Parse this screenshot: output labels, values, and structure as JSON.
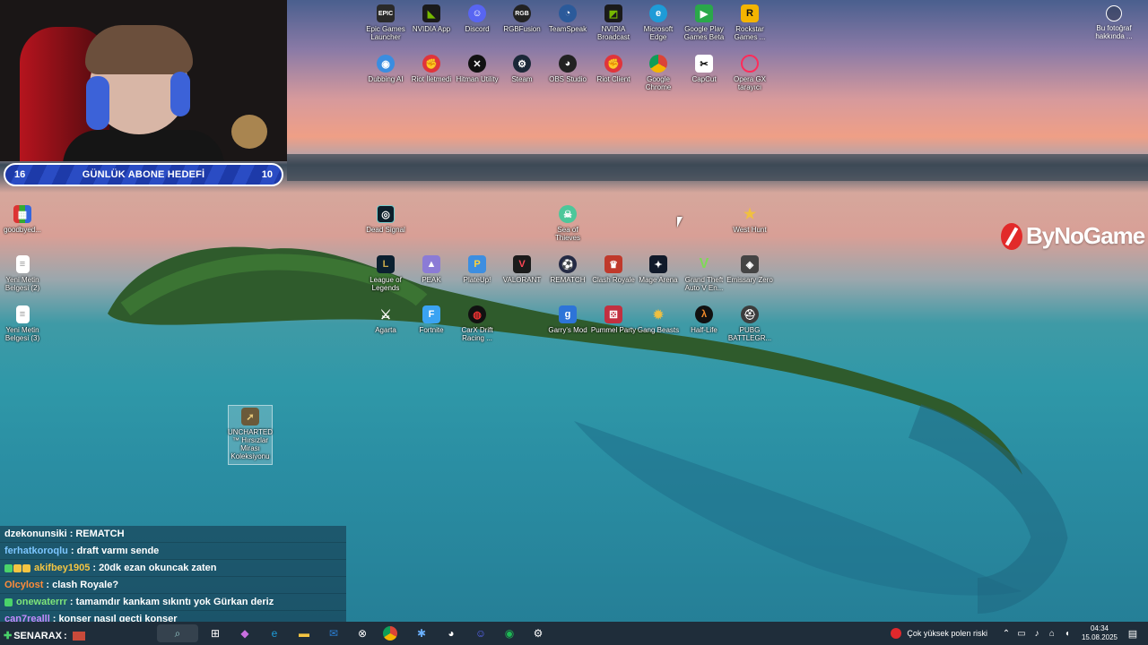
{
  "subgoal": {
    "left_value": "16",
    "title": "GÜNLÜK ABONE HEDEFİ",
    "right_value": "10"
  },
  "watermark": "ByNoGame",
  "photo_info": {
    "label": "Bu fotoğraf hakkında ..."
  },
  "desktop_icons": {
    "epic": "Epic Games Launcher",
    "nvidia_app": "NVIDIA App",
    "discord": "Discord",
    "rgbfusion": "RGBFusion",
    "teamspeak": "TeamSpeak",
    "nvidia_broadcast": "NVIDIA Broadcast",
    "edge": "Microsoft Edge",
    "gplay": "Google Play Games Beta",
    "rockstar": "Rockstar Games ...",
    "dubbing": "Dubbing AI",
    "riot_iletmedi": "Riot İletmedi",
    "hitman": "Hitman Utility",
    "steam": "Steam",
    "obs": "OBS Studio",
    "riot_client": "Riot Client",
    "chrome": "Google Chrome",
    "capcut": "CapCut",
    "opera": "Opera GX tarayıcı",
    "goodbye": "goodbyed...",
    "yeni2": "Yeni Metin Belgesi (2)",
    "yeni3": "Yeni Metin Belgesi (3)",
    "dead_signal": "Dead Signal",
    "sea_of_thieves": "Sea of Thieves",
    "west_hunt": "West Hunt",
    "lol": "League of Legends",
    "peak": "PEAK",
    "plateup": "PlateUp!",
    "valorant": "VALORANT",
    "rematch": "REMATCH",
    "clash": "Clash Royale",
    "mage_arena": "Mage Arena",
    "gta": "Grand Theft Auto V En...",
    "emissary": "Emissary Zero",
    "agarta": "Agarta",
    "fortnite": "Fortnite",
    "carx": "CarX Drift Racing ...",
    "garrys": "Garry's Mod",
    "pummel": "Pummel Party",
    "gang_beasts": "Gang Beasts",
    "half_life": "Half-Life",
    "pubg": "PUBG BATTLEGR...",
    "uncharted": "UNCHARTED™ Hırsızlar Mirası Koleksiyonu"
  },
  "chat": [
    {
      "user": "dzekonunsiki",
      "user_color": "#ffffff",
      "message": "REMATCH",
      "badges": []
    },
    {
      "user": "ferhatkoroqlu",
      "user_color": "#7cc6ff",
      "message": "draft varmı sende",
      "badges": []
    },
    {
      "user": "akifbey1905",
      "user_color": "#f4c542",
      "message": "20dk ezan okuncak zaten",
      "badges": [
        "#4ad36a",
        "#f4c542",
        "#f4c542"
      ]
    },
    {
      "user": "Olcylost",
      "user_color": "#ff8c3a",
      "message": "clash Royale?",
      "badges": []
    },
    {
      "user": "onewaterrr",
      "user_color": "#7ee57a",
      "message": "tamamdır kankam sıkıntı yok Gürkan deriz",
      "badges": [
        "#4ad36a"
      ]
    },
    {
      "user": "can7realll",
      "user_color": "#c58bff",
      "message": "konser nasıl geçti konser",
      "badges": []
    }
  ],
  "overlay_user": "SENARAX",
  "taskbar": {
    "weather": "Çok yüksek polen riski",
    "time": "04:34",
    "date": "15.08.2025"
  }
}
